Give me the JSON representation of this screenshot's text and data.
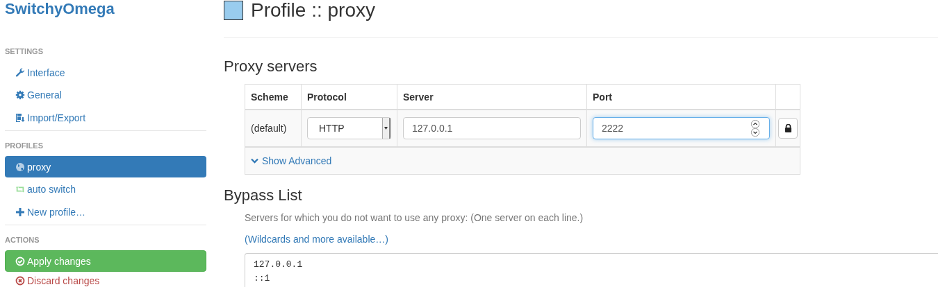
{
  "app": {
    "title": "SwitchyOmega"
  },
  "sidebar": {
    "sections": [
      {
        "heading": "SETTINGS",
        "items": [
          {
            "label": "Interface",
            "kind": "wrench",
            "selected": false
          },
          {
            "label": "General",
            "kind": "gear",
            "selected": false
          },
          {
            "label": "Import/Export",
            "kind": "import",
            "selected": false
          }
        ]
      },
      {
        "heading": "PROFILES",
        "items": [
          {
            "label": "proxy",
            "kind": "globe",
            "selected": true
          },
          {
            "label": "auto switch",
            "kind": "repeat",
            "selected": false
          },
          {
            "label": "New profile…",
            "kind": "plus",
            "selected": false
          }
        ]
      },
      {
        "heading": "ACTIONS",
        "items": [
          {
            "label": "Apply changes",
            "kind": "apply"
          },
          {
            "label": "Discard changes",
            "kind": "discard"
          }
        ]
      }
    ]
  },
  "page": {
    "title": "Profile :: proxy",
    "color": "#99ccee"
  },
  "proxy_servers": {
    "heading": "Proxy servers",
    "columns": [
      "Scheme",
      "Protocol",
      "Server",
      "Port"
    ],
    "rows": [
      {
        "scheme": "(default)",
        "protocol": "HTTP",
        "server": "127.0.0.1",
        "port": "2222",
        "port_focused": true
      }
    ],
    "show_advanced": {
      "label": "Show Advanced",
      "expanded": false
    }
  },
  "bypass": {
    "heading": "Bypass List",
    "description": "Servers for which you do not want to use any proxy: (One server on each line.)",
    "link": "(Wildcards and more available…)",
    "lines": [
      "127.0.0.1",
      "::1"
    ]
  }
}
